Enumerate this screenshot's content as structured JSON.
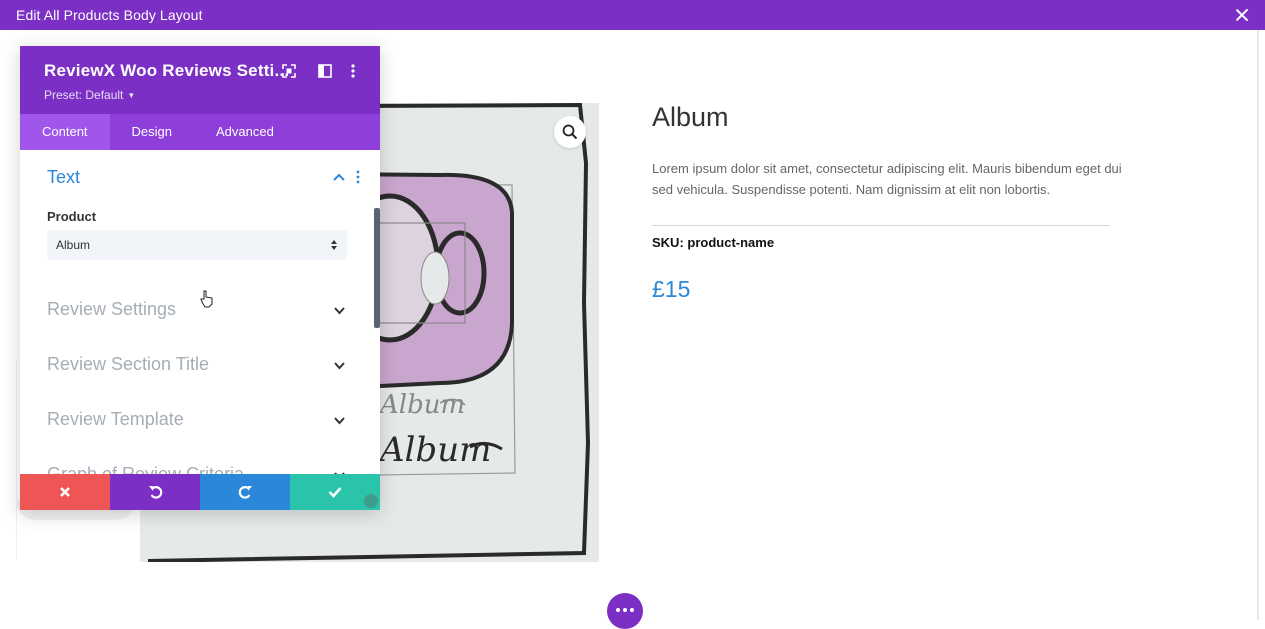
{
  "topbar": {
    "title": "Edit All Products Body Layout"
  },
  "modal": {
    "title": "ReviewX Woo Reviews Setti...",
    "preset": "Preset: Default",
    "tabs": [
      {
        "label": "Content",
        "active": true
      },
      {
        "label": "Design",
        "active": false
      },
      {
        "label": "Advanced",
        "active": false
      }
    ],
    "text_section": {
      "title": "Text",
      "product_label": "Product",
      "product_value": "Album"
    },
    "toggles": [
      {
        "label": "Review Settings"
      },
      {
        "label": "Review Section Title"
      },
      {
        "label": "Review Template"
      },
      {
        "label": "Graph of Review Criteria"
      }
    ]
  },
  "product": {
    "title": "Album",
    "description": "Lorem ipsum dolor sit amet, consectetur adipiscing elit. Mauris bibendum eget dui sed vehicula. Suspendisse potenti. Nam dignissim at elit non lobortis.",
    "sku_label": "SKU:",
    "sku_value": "product-name",
    "price": "£15"
  },
  "image": {
    "handwriting_1": "Album",
    "handwriting_2": "Album"
  },
  "colors": {
    "brand_purple": "#7b2fc4",
    "tab_purple": "#8e3fd9",
    "accent_blue": "#2b87da",
    "discard_red": "#ef5555",
    "save_green": "#29c4a9"
  },
  "icons": [
    "close-icon",
    "zoom-icon",
    "expand-icon",
    "sidebar-icon",
    "more-vertical-icon",
    "chevron-up-icon",
    "chevron-down-icon",
    "select-arrows-icon",
    "discard-icon",
    "undo-icon",
    "redo-icon",
    "save-check-icon",
    "more-dots-icon",
    "resize-icon",
    "pointer-cursor-icon"
  ]
}
